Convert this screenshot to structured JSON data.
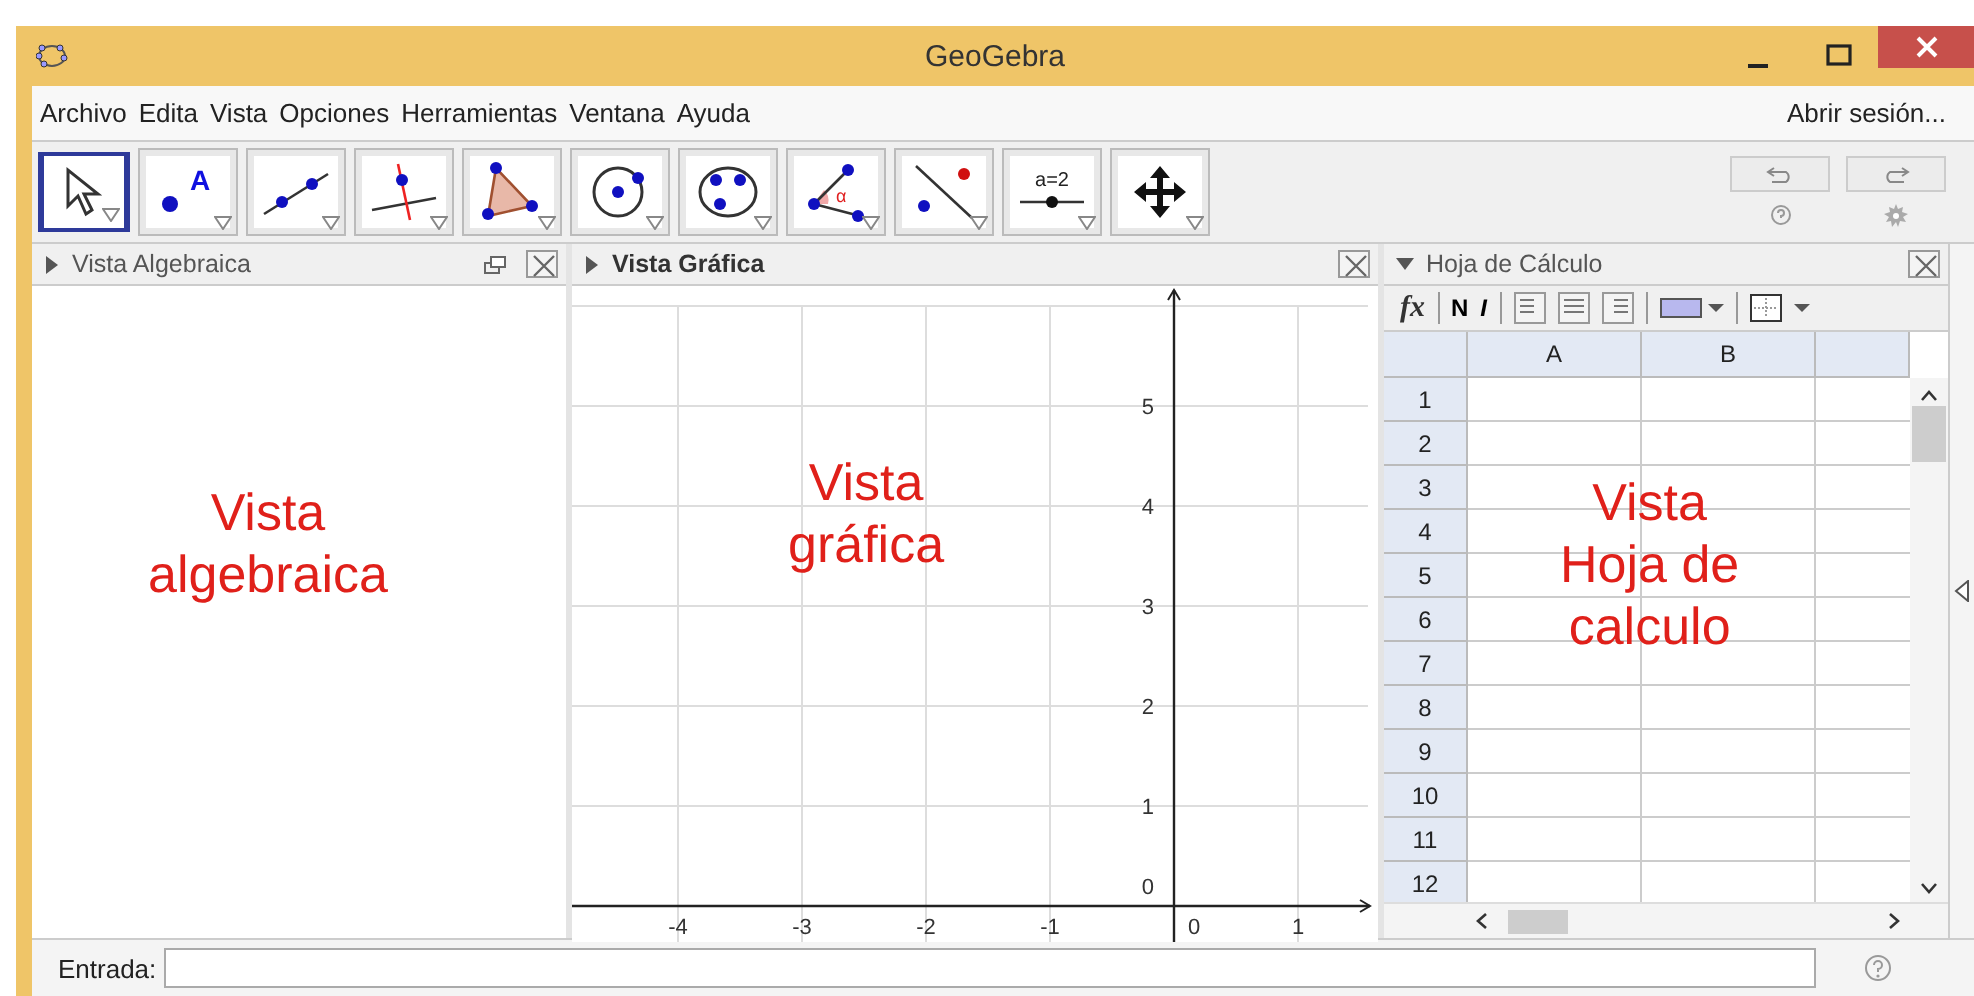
{
  "window": {
    "title": "GeoGebra"
  },
  "menu": {
    "items": [
      "Archivo",
      "Edita",
      "Vista",
      "Opciones",
      "Herramientas",
      "Ventana",
      "Ayuda"
    ],
    "sign_in": "Abrir sesión..."
  },
  "toolbar": {
    "tools": [
      {
        "kind": "move",
        "selected": true
      },
      {
        "kind": "point",
        "label": "A",
        "selected": false
      },
      {
        "kind": "line",
        "selected": false
      },
      {
        "kind": "perpendicular",
        "selected": false
      },
      {
        "kind": "polygon",
        "selected": false
      },
      {
        "kind": "circle",
        "selected": false
      },
      {
        "kind": "conic",
        "selected": false
      },
      {
        "kind": "angle",
        "label": "α",
        "selected": false
      },
      {
        "kind": "reflect",
        "selected": false
      },
      {
        "kind": "slider",
        "label": "a=2",
        "selected": false
      },
      {
        "kind": "pan",
        "selected": false
      }
    ]
  },
  "algebra_view": {
    "title": "Vista Algebraica",
    "expanded": false,
    "annotation": [
      "Vista",
      "algebraica"
    ]
  },
  "graphics_view": {
    "title": "Vista Gráfica",
    "expanded": false,
    "annotation": [
      "Vista",
      "gráfica"
    ],
    "x_ticks": [
      "-4",
      "-3",
      "-2",
      "-1",
      "0",
      "1"
    ],
    "y_ticks": [
      "5",
      "4",
      "3",
      "2",
      "1",
      "0"
    ]
  },
  "spreadsheet": {
    "title": "Hoja de Cálculo",
    "expanded": true,
    "style_bar": {
      "function": "fx",
      "bold": "N",
      "italic": "I"
    },
    "columns": [
      "A",
      "B"
    ],
    "rows": [
      "1",
      "2",
      "3",
      "4",
      "5",
      "6",
      "7",
      "8",
      "9",
      "10",
      "11",
      "12"
    ],
    "annotation": [
      "Vista",
      "Hoja de",
      "calculo"
    ]
  },
  "input_bar": {
    "label": "Entrada:"
  }
}
